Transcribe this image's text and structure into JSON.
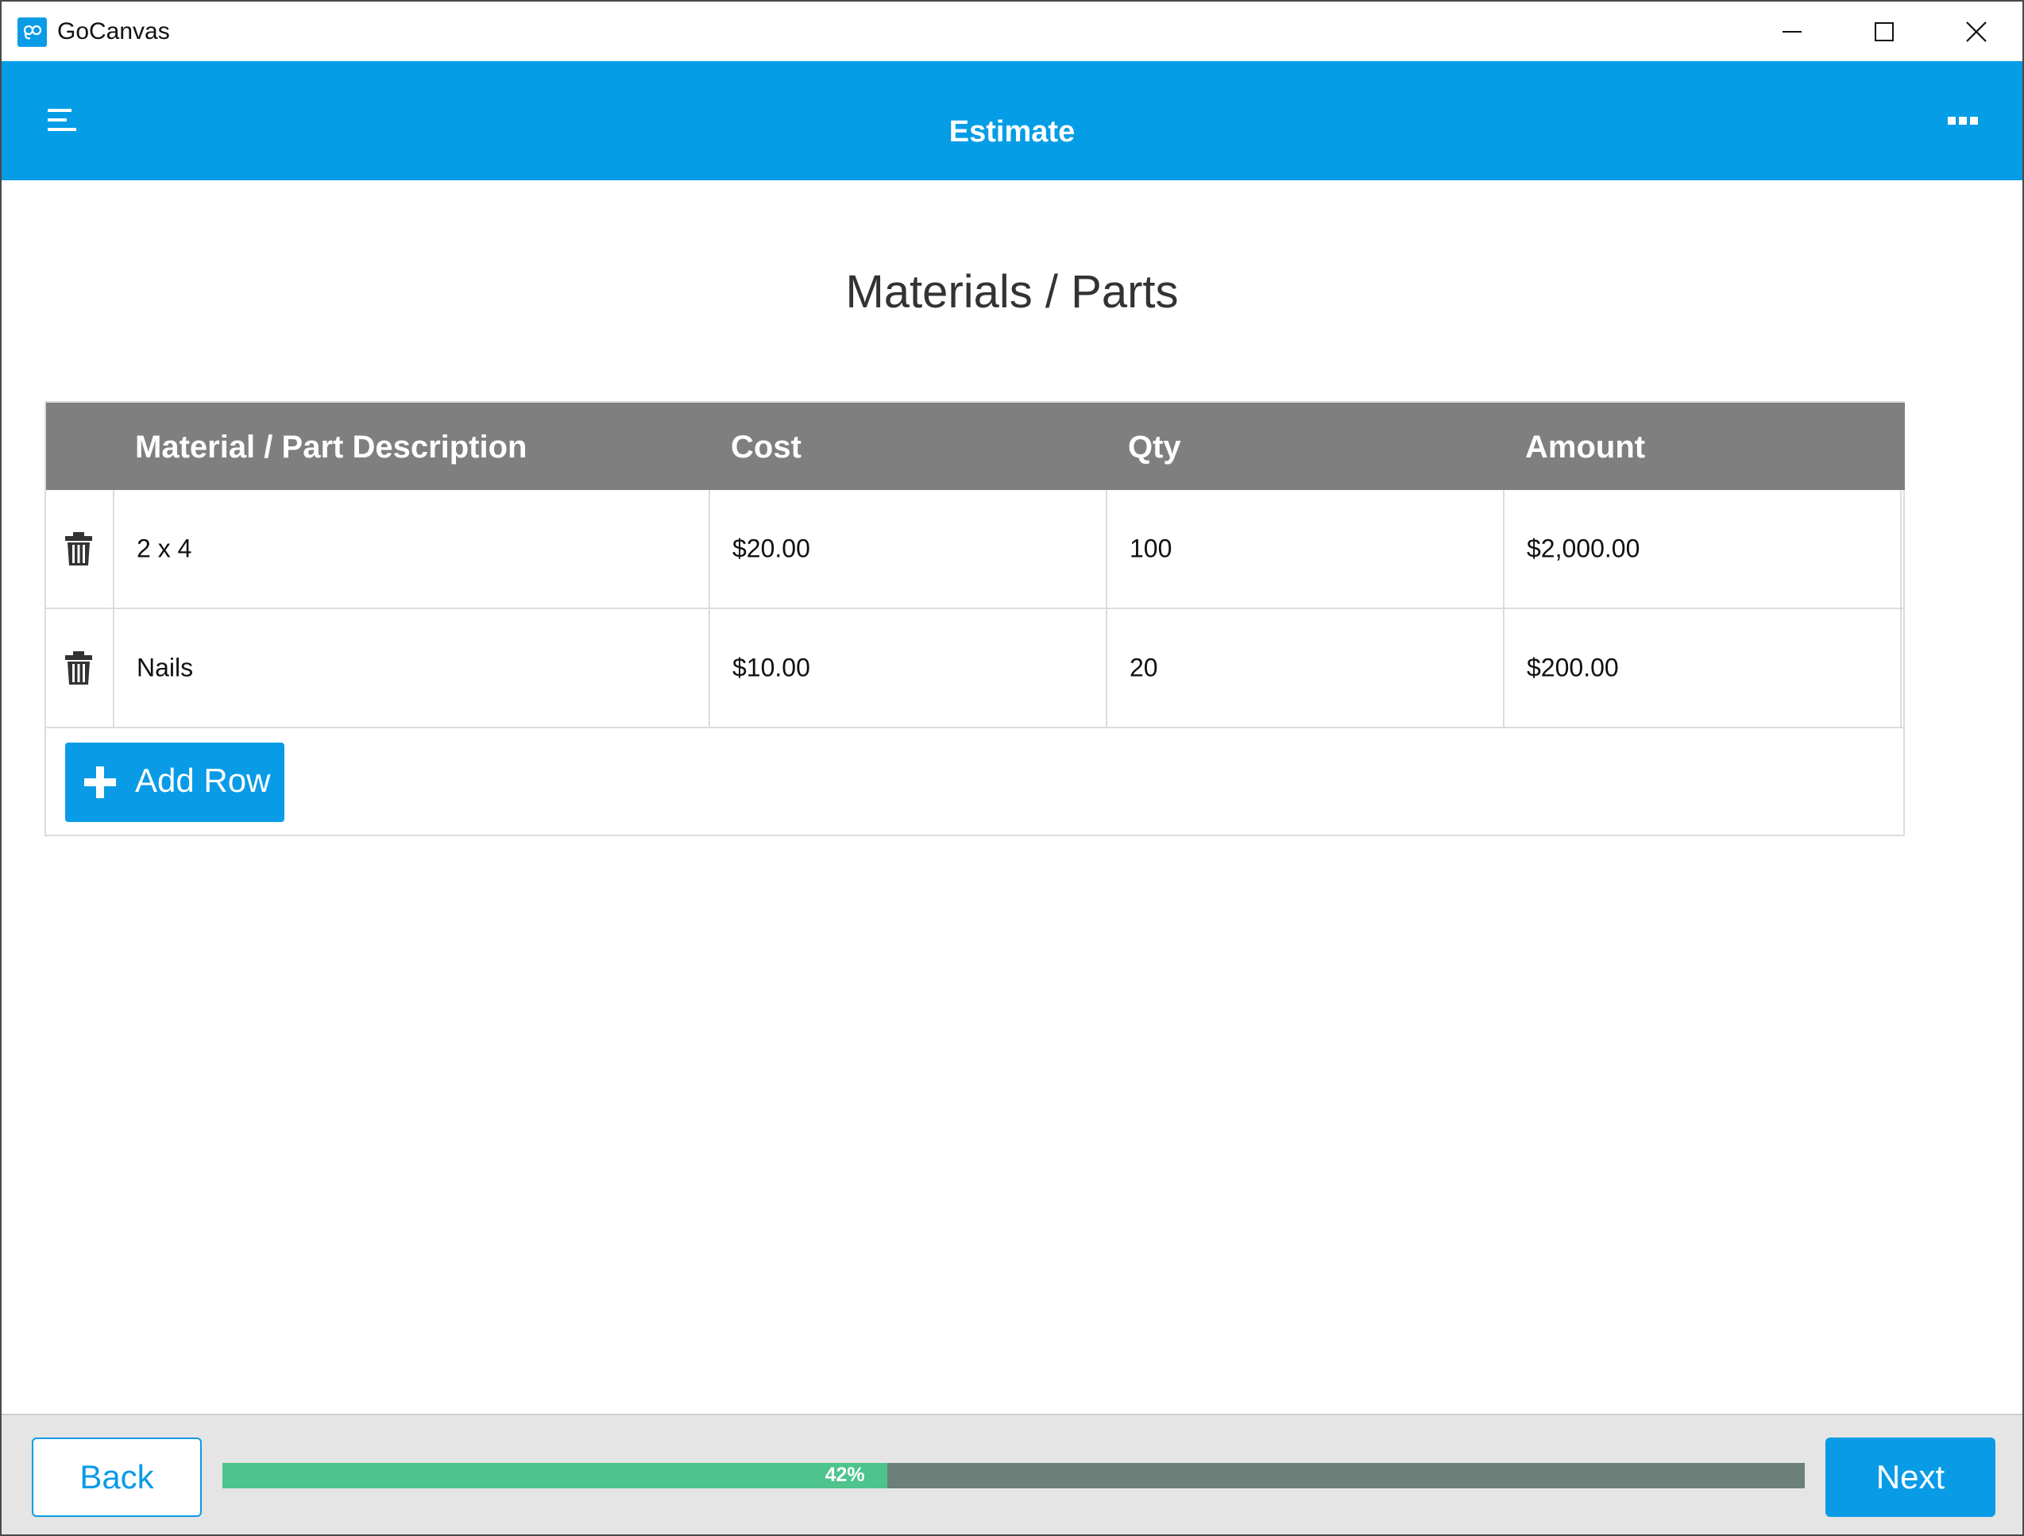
{
  "window": {
    "app_title": "GoCanvas",
    "controls": {
      "minimize": "minimize-icon",
      "maximize": "maximize-icon",
      "close": "close-icon"
    }
  },
  "header": {
    "title": "Estimate",
    "menu_icon": "hamburger-menu-icon",
    "more_icon": "more-options-icon",
    "background_color": "#049de6"
  },
  "section": {
    "title": "Materials / Parts"
  },
  "table": {
    "columns": [
      "Material / Part Description",
      "Cost",
      "Qty",
      "Amount"
    ],
    "rows": [
      {
        "description": "2 x 4",
        "cost": "$20.00",
        "qty": "100",
        "amount": "$2,000.00"
      },
      {
        "description": "Nails",
        "cost": "$10.00",
        "qty": "20",
        "amount": "$200.00"
      }
    ],
    "delete_icon": "trash-icon",
    "header_color": "#7f7f7f"
  },
  "add_row": {
    "label": "Add Row",
    "icon": "plus-icon"
  },
  "footer": {
    "back_label": "Back",
    "next_label": "Next",
    "progress_percent": 42,
    "progress_label": "42%",
    "progress_fill_color": "#4dc48c",
    "progress_track_color": "#6b8079"
  }
}
